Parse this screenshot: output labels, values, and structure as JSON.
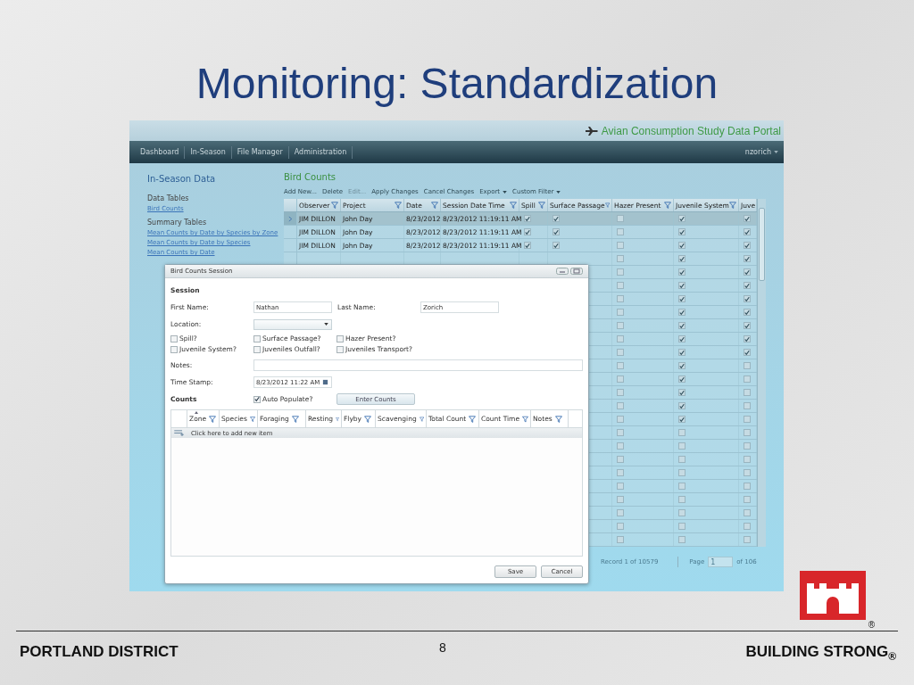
{
  "slide": {
    "title": "Monitoring: Standardization",
    "footer_left": "PORTLAND DISTRICT",
    "page_number": "8",
    "footer_right": "BUILDING STRONG$_{®}$",
    "logo_mark": "®"
  },
  "app": {
    "portal_title": "Avian Consumption Study Data Portal",
    "nav": [
      {
        "label": "Dashboard"
      },
      {
        "label": "In-Season"
      },
      {
        "label": "File Manager"
      },
      {
        "label": "Administration"
      }
    ],
    "user": "nzorich",
    "sidebar": {
      "title": "In-Season Data",
      "sections": [
        {
          "heading": "Data Tables",
          "links": [
            "Bird Counts"
          ]
        },
        {
          "heading": "Summary Tables",
          "links": [
            "Mean Counts by Date by Species by Zone",
            "Mean Counts by Date by Species",
            "Mean Counts by Date"
          ]
        }
      ]
    },
    "main": {
      "title": "Bird Counts",
      "toolbar": [
        {
          "label": "Add New...",
          "disabled": false,
          "dropdown": false
        },
        {
          "label": "Delete",
          "disabled": false,
          "dropdown": false
        },
        {
          "label": "Edit...",
          "disabled": true,
          "dropdown": false
        },
        {
          "label": "Apply Changes",
          "disabled": false,
          "dropdown": false
        },
        {
          "label": "Cancel Changes",
          "disabled": false,
          "dropdown": false
        },
        {
          "label": "Export",
          "disabled": false,
          "dropdown": true
        },
        {
          "label": "Custom Filter",
          "disabled": false,
          "dropdown": true
        }
      ],
      "grid": {
        "columns": [
          {
            "label": "Observer",
            "kind": "text",
            "filter": true
          },
          {
            "label": "Project",
            "kind": "text",
            "filter": true
          },
          {
            "label": "Date",
            "kind": "text",
            "filter": true
          },
          {
            "label": "Session Date Time",
            "kind": "text",
            "filter": true
          },
          {
            "label": "Spill",
            "kind": "check",
            "filter": true
          },
          {
            "label": "Surface Passage",
            "kind": "check",
            "filter": true
          },
          {
            "label": "Hazer Present",
            "kind": "check",
            "filter": true
          },
          {
            "label": "Juvenile System",
            "kind": "check",
            "filter": true
          },
          {
            "label": "Juve",
            "kind": "check"
          }
        ],
        "rows": [
          {
            "selected": true,
            "cells": [
              "JIM DILLON",
              "John Day",
              "8/23/2012",
              "8/23/2012 11:19:11 AM"
            ],
            "checks": [
              true,
              true,
              false,
              true,
              true
            ]
          },
          {
            "selected": false,
            "cells": [
              "JIM DILLON",
              "John Day",
              "8/23/2012",
              "8/23/2012 11:19:11 AM"
            ],
            "checks": [
              true,
              true,
              false,
              true,
              true
            ]
          },
          {
            "selected": false,
            "cells": [
              "JIM DILLON",
              "John Day",
              "8/23/2012",
              "8/23/2012 11:19:11 AM"
            ],
            "checks": [
              true,
              true,
              false,
              true,
              true
            ]
          },
          {
            "checks": [
              false,
              true,
              true
            ]
          },
          {
            "checks": [
              false,
              true,
              true
            ]
          },
          {
            "checks": [
              false,
              true,
              true
            ]
          },
          {
            "checks": [
              false,
              true,
              true
            ]
          },
          {
            "checks": [
              false,
              true,
              true
            ]
          },
          {
            "checks": [
              false,
              true,
              true
            ]
          },
          {
            "checks": [
              false,
              true,
              true
            ]
          },
          {
            "checks": [
              false,
              true,
              true
            ]
          },
          {
            "checks": [
              false,
              true,
              false
            ]
          },
          {
            "checks": [
              false,
              true,
              false
            ]
          },
          {
            "checks": [
              false,
              true,
              false
            ]
          },
          {
            "checks": [
              false,
              true,
              false
            ]
          },
          {
            "checks": [
              false,
              true,
              false
            ]
          },
          {
            "checks": [
              false,
              false,
              false
            ]
          },
          {
            "checks": [
              false,
              false,
              false
            ]
          },
          {
            "checks": [
              false,
              false,
              false
            ]
          },
          {
            "checks": [
              false,
              false,
              false
            ]
          },
          {
            "checks": [
              false,
              false,
              false
            ]
          },
          {
            "checks": [
              false,
              false,
              false
            ]
          },
          {
            "checks": [
              false,
              false,
              false
            ]
          },
          {
            "checks": [
              false,
              false,
              false
            ]
          },
          {
            "checks": [
              false,
              false,
              false
            ]
          }
        ]
      },
      "pager": {
        "record": "Record 1 of 10579",
        "page_label": "Page",
        "page_value": "1",
        "page_count": "of 106"
      }
    }
  },
  "dialog": {
    "title": "Bird Counts Session",
    "section": "Session",
    "first_name": {
      "label": "First Name:",
      "value": "Nathan"
    },
    "last_name": {
      "label": "Last Name:",
      "value": "Zorich"
    },
    "location": {
      "label": "Location:"
    },
    "options": [
      {
        "label": "Spill?",
        "checked": false
      },
      {
        "label": "Surface Passage?",
        "checked": false
      },
      {
        "label": "Hazer Present?",
        "checked": false
      },
      {
        "label": "Juvenile System?",
        "checked": false
      },
      {
        "label": "Juveniles Outfall?",
        "checked": false
      },
      {
        "label": "Juveniles Transport?",
        "checked": false
      }
    ],
    "notes": {
      "label": "Notes:"
    },
    "time_stamp": {
      "label": "Time Stamp:",
      "value": "8/23/2012 11:22 AM"
    },
    "counts_label": "Counts",
    "auto_populate": {
      "label": "Auto Populate?",
      "checked": true
    },
    "enter_counts": "Enter Counts",
    "count_columns": [
      {
        "label": "Zone",
        "sorted": true
      },
      {
        "label": "Species",
        "sorted": false
      },
      {
        "label": "Foraging",
        "sorted": false
      },
      {
        "label": "Resting",
        "sorted": false
      },
      {
        "label": "Flyby",
        "sorted": false
      },
      {
        "label": "Scavenging",
        "sorted": false
      },
      {
        "label": "Total Count",
        "sorted": false
      },
      {
        "label": "Count Time",
        "sorted": false
      },
      {
        "label": "Notes",
        "sorted": false
      }
    ],
    "add_row": "Click here to add new item",
    "buttons": [
      "Save",
      "Cancel"
    ]
  }
}
